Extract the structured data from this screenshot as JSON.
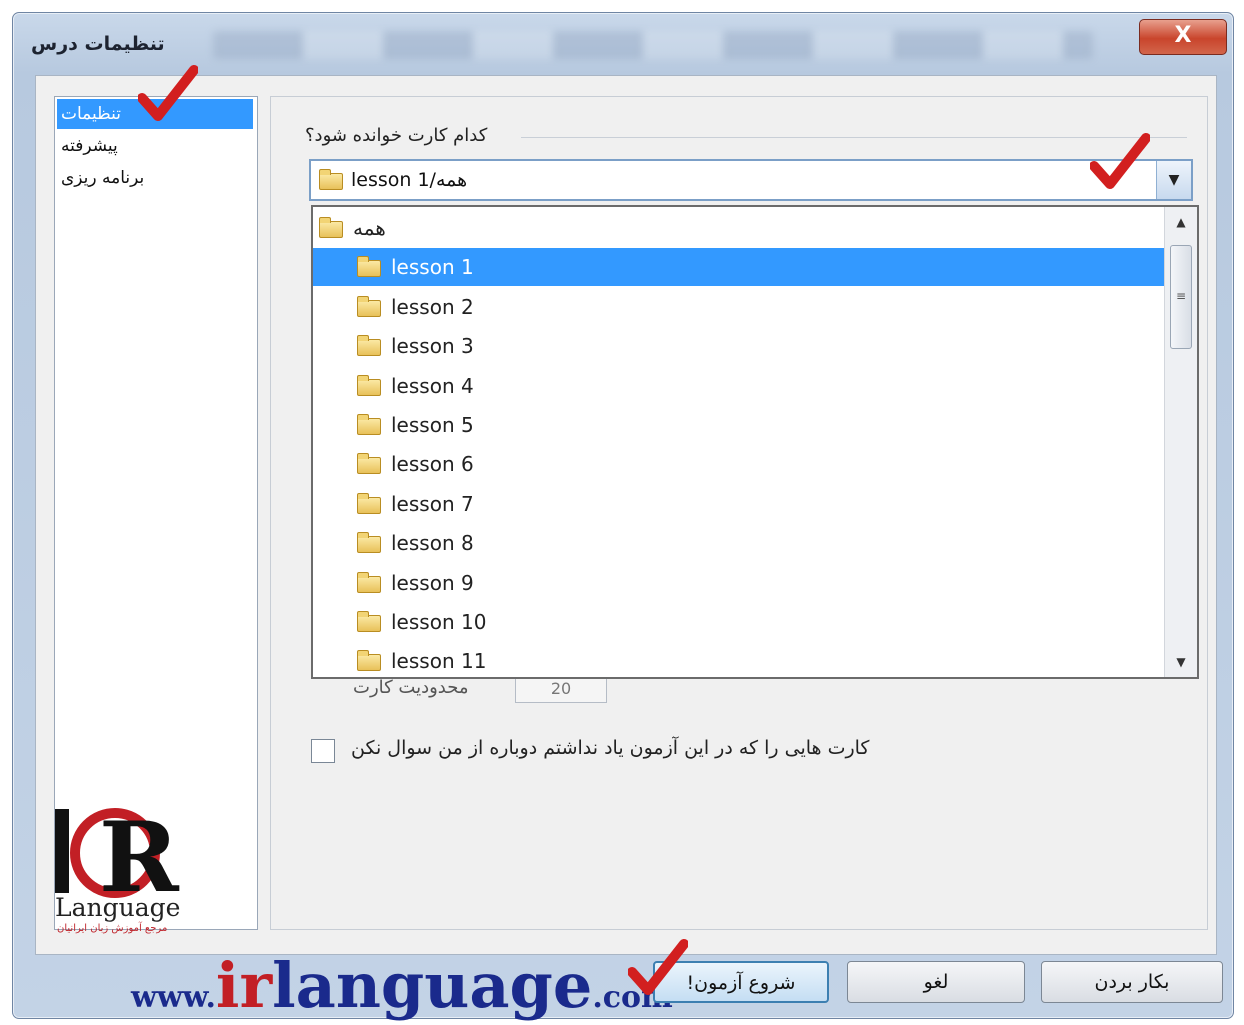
{
  "window": {
    "title": "تنظیمات درس",
    "close_label": "X"
  },
  "nav": {
    "items": [
      {
        "label": "تنظیمات"
      },
      {
        "label": "پیشرفته"
      },
      {
        "label": "برنامه ریزی"
      }
    ]
  },
  "logo": {
    "language": "Language",
    "tagline": "مرجع آموزش زبان ایرانیان"
  },
  "main": {
    "question": "کدام کارت خوانده شود؟",
    "combo_value": "lesson 1/همه",
    "dropdown": {
      "items": [
        {
          "label": "همه",
          "level": 0
        },
        {
          "label": "lesson 1",
          "level": 1
        },
        {
          "label": "lesson 2",
          "level": 1
        },
        {
          "label": "lesson 3",
          "level": 1
        },
        {
          "label": "lesson 4",
          "level": 1
        },
        {
          "label": "lesson 5",
          "level": 1
        },
        {
          "label": "lesson 6",
          "level": 1
        },
        {
          "label": "lesson 7",
          "level": 1
        },
        {
          "label": "lesson 8",
          "level": 1
        },
        {
          "label": "lesson 9",
          "level": 1
        },
        {
          "label": "lesson 10",
          "level": 1
        },
        {
          "label": "lesson 11",
          "level": 1
        }
      ],
      "selected_index": 1
    },
    "card_limit_label": "محدودیت کارت",
    "card_limit_value": "20",
    "dont_ask_again_label": "کارت هایی را که در این آزمون یاد نداشتم دوباره از من سوال نکن"
  },
  "watermark": {
    "www": "www.",
    "ir": "ir",
    "language": "language",
    "com": ".com"
  },
  "buttons": {
    "start": "شروع آزمون!",
    "cancel": "لغو",
    "apply": "بکار بردن"
  },
  "colors": {
    "selection": "#3399ff",
    "check_mark": "#d21f1f",
    "watermark_blue": "#1a2a8c",
    "watermark_red": "#c21f25"
  }
}
